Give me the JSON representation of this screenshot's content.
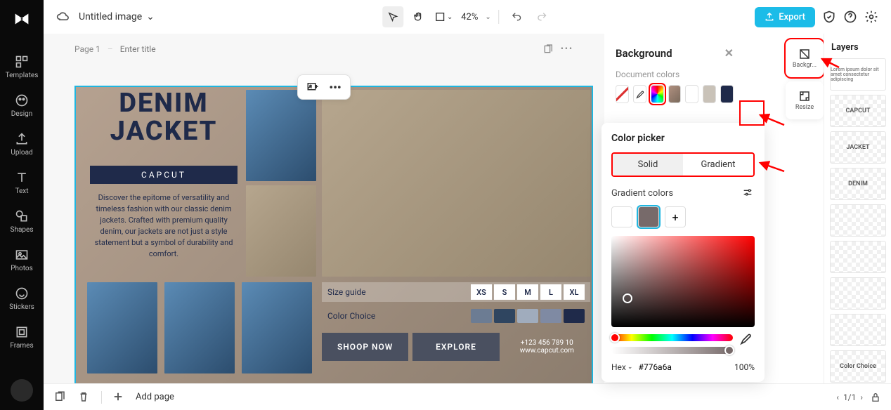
{
  "topbar": {
    "doc_title": "Untitled image",
    "zoom": "42%",
    "export_label": "Export"
  },
  "sidebar": {
    "items": [
      {
        "label": "Templates"
      },
      {
        "label": "Design"
      },
      {
        "label": "Upload"
      },
      {
        "label": "Text"
      },
      {
        "label": "Shapes"
      },
      {
        "label": "Photos"
      },
      {
        "label": "Stickers"
      },
      {
        "label": "Frames"
      }
    ]
  },
  "page": {
    "label": "Page 1",
    "title_placeholder": "Enter title"
  },
  "design": {
    "title_line1": "DENIM",
    "title_line2": "JACKET",
    "badge": "CAPCUT",
    "desc": "Discover the epitome of versatility and timeless fashion with our classic denim jackets. Crafted with premium quality denim, our jackets are not just a style statement but a symbol of durability and comfort.",
    "size_label": "Size guide",
    "sizes": [
      "XS",
      "S",
      "M",
      "L",
      "XL"
    ],
    "color_label": "Color Choice",
    "colors": [
      "#6c7c93",
      "#2f4560",
      "#a0acbd",
      "#7f8aa3",
      "#1f2a4a"
    ],
    "cta1": "SHOOP NOW",
    "cta2": "EXPLORE",
    "phone": "+123 456 789 10",
    "url": "www.capcut.com"
  },
  "panel": {
    "title": "Background",
    "doc_colors_label": "Document colors"
  },
  "right_tools": {
    "items": [
      {
        "label": "Backgr..."
      },
      {
        "label": "Resize"
      }
    ]
  },
  "color_picker": {
    "title": "Color picker",
    "tab_solid": "Solid",
    "tab_gradient": "Gradient",
    "gradient_label": "Gradient colors",
    "hex_mode": "Hex",
    "hex_value": "#776a6a",
    "opacity": "100%",
    "stops": [
      "#ffffff",
      "#776a6a"
    ]
  },
  "layers": {
    "title": "Layers",
    "items": [
      "",
      "CAPCUT",
      "JACKET",
      "DENIM",
      "",
      "",
      "",
      "",
      "Color Choice"
    ]
  },
  "bottombar": {
    "add_page": "Add page",
    "page_nav": "1/1"
  }
}
